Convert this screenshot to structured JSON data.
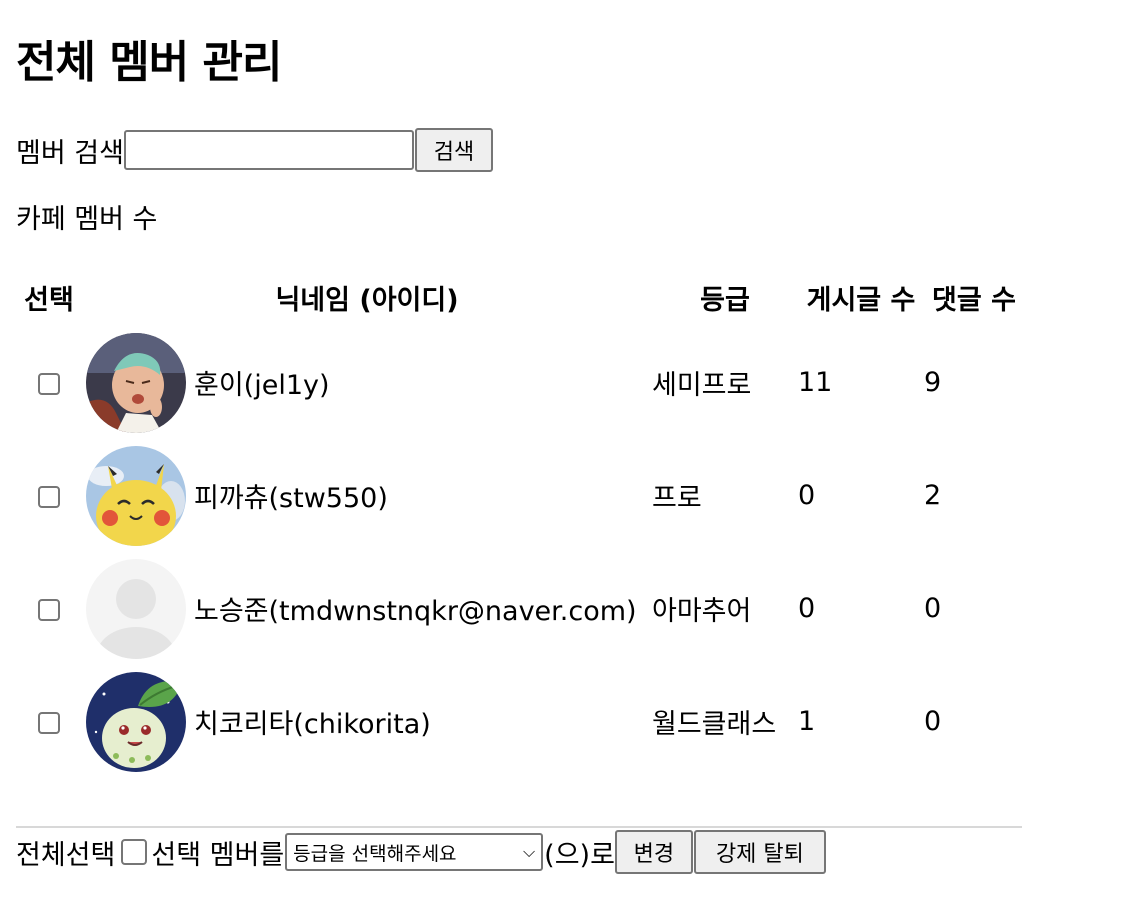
{
  "page": {
    "title": "전체 멤버 관리",
    "search_label": "멤버 검색",
    "search_value": "",
    "search_button": "검색",
    "member_count_label": "카페 멤버 수"
  },
  "table": {
    "headers": {
      "select": "선택",
      "nickname": "닉네임 (아이디)",
      "grade": "등급",
      "posts": "게시글 수",
      "comments": "댓글 수"
    },
    "rows": [
      {
        "nickname": "훈이(jel1y)",
        "grade": "세미프로",
        "posts": "11",
        "comments": "9",
        "avatar": "character-avatar-icon",
        "checked": false
      },
      {
        "nickname": "피까츄(stw550)",
        "grade": "프로",
        "posts": "0",
        "comments": "2",
        "avatar": "pikachu-avatar-icon",
        "checked": false
      },
      {
        "nickname": "노승준(tmdwnstnqkr@naver.com)",
        "grade": "아마추어",
        "posts": "0",
        "comments": "0",
        "avatar": "default-avatar-icon",
        "checked": false
      },
      {
        "nickname": "치코리타(chikorita)",
        "grade": "월드클래스",
        "posts": "1",
        "comments": "0",
        "avatar": "chikorita-avatar-icon",
        "checked": false
      }
    ]
  },
  "footer": {
    "select_all_label": "전체선택",
    "selected_members_label": "선택 멤버를",
    "grade_select_value": "등급을 선택해주세요",
    "suffix_label": "(으)로",
    "change_button": "변경",
    "withdraw_button": "강제 탈퇴"
  },
  "colors": {
    "border": "#767676",
    "button_bg": "#efefef",
    "divider": "#d8d8d8"
  }
}
